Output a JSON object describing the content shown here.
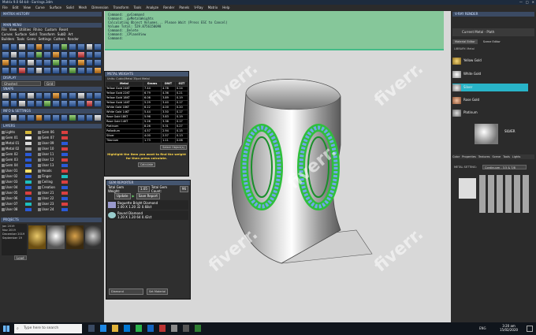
{
  "window": {
    "title": "Matrix 9.0 64-bit - Earrings.3dm",
    "controls": [
      "—",
      "□",
      "✕"
    ]
  },
  "menubar": [
    "File",
    "Edit",
    "View",
    "Curve",
    "Surface",
    "Solid",
    "Mesh",
    "Dimension",
    "Transform",
    "Tools",
    "Analyze",
    "Render",
    "Panels",
    "V-Ray",
    "Matrix",
    "Help"
  ],
  "left": {
    "section_main": "MATRIX HISTORY",
    "section_menu": "MAIN MENU",
    "menu_row1": [
      "File",
      "View",
      "Utilities",
      "Rhino",
      "Custom",
      "Reset"
    ],
    "menu_row2": [
      "Curves",
      "Surface",
      "Solid",
      "Transform",
      "SubD",
      "Art"
    ],
    "menu_row3": [
      "Builders",
      "Tools",
      "Gems",
      "Settings",
      "Cutters",
      "Render"
    ],
    "section_display": "DISPLAY",
    "display_mode": "Ghosted",
    "display_mode2": "Grid",
    "section_snaps": "SNAPS",
    "section_info": "INFO & SETTINGS",
    "section_layers": "LAYERS",
    "layers_left": [
      "Lights",
      "Gem 01",
      "Metal 01",
      "Metal 02",
      "Gem 02",
      "Gem 03",
      "Gem 04",
      "User 01",
      "User 02",
      "User 03",
      "User 04",
      "User 05",
      "User 06",
      "User 07",
      "User 08"
    ],
    "layers_right": [
      "Gem 06",
      "Gem 07",
      "User 09",
      "User 10",
      "User 11",
      "User 12",
      "User 13",
      "Heads",
      "Finger",
      "Ceiling",
      "Creation",
      "User 21",
      "User 22",
      "User 23",
      "User 24"
    ],
    "section_projects": "PROJECTS",
    "project_dates": [
      "Jan 2019",
      "Nov 2019",
      "December 2019",
      "September 19"
    ],
    "project_btn": "Load"
  },
  "command": {
    "lines": [
      "Command: _gvCommand",
      "Command: _gvMetalWeights",
      "Calculating Object Volumes... Please Wait (Press ESC to Cancel)",
      "Volume Total: 529.8756150098",
      "Command: _Delete",
      "Command: _CPlaneView",
      "Command:"
    ]
  },
  "metal": {
    "title": "METAL WEIGHTS",
    "label": "Units: Cubic/Metal 35pct Metal",
    "headers": [
      "Metal",
      "Grams",
      "DWT",
      "OZT"
    ],
    "rows": [
      [
        "Yellow Gold 24KT",
        "7.44",
        "4.78",
        "0.24"
      ],
      [
        "Yellow Gold 22KT",
        "6.79",
        "4.36",
        "0.21"
      ],
      [
        "Yellow Gold 18KT",
        "6.06",
        "3.89",
        "0.19"
      ],
      [
        "Yellow Gold 14KT",
        "5.29",
        "3.40",
        "0.17"
      ],
      [
        "White Gold 18KT",
        "6.22",
        "4.00",
        "0.20"
      ],
      [
        "White Gold 14KT",
        "5.44",
        "3.50",
        "0.17"
      ],
      [
        "Rose Gold 18KT",
        "5.96",
        "3.83",
        "0.19"
      ],
      [
        "Rose Gold 14KT",
        "5.26",
        "3.38",
        "0.17"
      ],
      [
        "Platinum",
        "8.26",
        "5.31",
        "0.27"
      ],
      [
        "Palladium",
        "4.57",
        "2.94",
        "0.15"
      ],
      [
        "Silver",
        "4.00",
        "2.57",
        "0.13"
      ],
      [
        "Titanium",
        "1.73",
        "1.11",
        "0.06"
      ]
    ],
    "button": "Select Object(s)",
    "hint": "Highlight the item you want to find the weight for then press calculate.",
    "calc": "Calculate"
  },
  "gem": {
    "title": "GEM REPORTER",
    "total_weight_label": "Total Gem Weight:",
    "total_weight": "1.05",
    "total_count_label": "Total Gem Count:",
    "total_count": "96",
    "update": "Update",
    "save": "Save Report",
    "rows": [
      {
        "shape": "Baguette",
        "stone": "Bright",
        "gem": "Diamond",
        "size": "2.00 X 1.20",
        "count": "32",
        "ct": "0.68ct"
      },
      {
        "shape": "Round",
        "stone": "",
        "gem": "Diamond",
        "size": "1.20 X 1.20",
        "count": "64",
        "ct": "0.42ct"
      }
    ],
    "material_select": "Diamond",
    "set_material": "Set Material"
  },
  "right": {
    "title": "V-RAY RENDER",
    "current": "Current Metal - Plath",
    "tabs": [
      "Material Editor",
      "Scene Editor"
    ],
    "library": "LIBRARY: Metal",
    "materials": [
      "Yellow Gold",
      "White Gold",
      "Silver",
      "Rose Gold",
      "Platinum"
    ],
    "selected_material": "Silver",
    "preview_label": "SILVER",
    "sub_tabs": [
      "Color",
      "Properties",
      "Textures",
      "Scene",
      "Tools",
      "Lights"
    ],
    "metal_setting_label": "METAL SETTING:",
    "metal_setting_value": "Continuum - 3.5 & 7/8"
  },
  "taskbar": {
    "search_placeholder": "Type here to search",
    "time": "3:20 am",
    "date": "15/02/2020",
    "lang": "ENG"
  },
  "watermark": "fiverr."
}
